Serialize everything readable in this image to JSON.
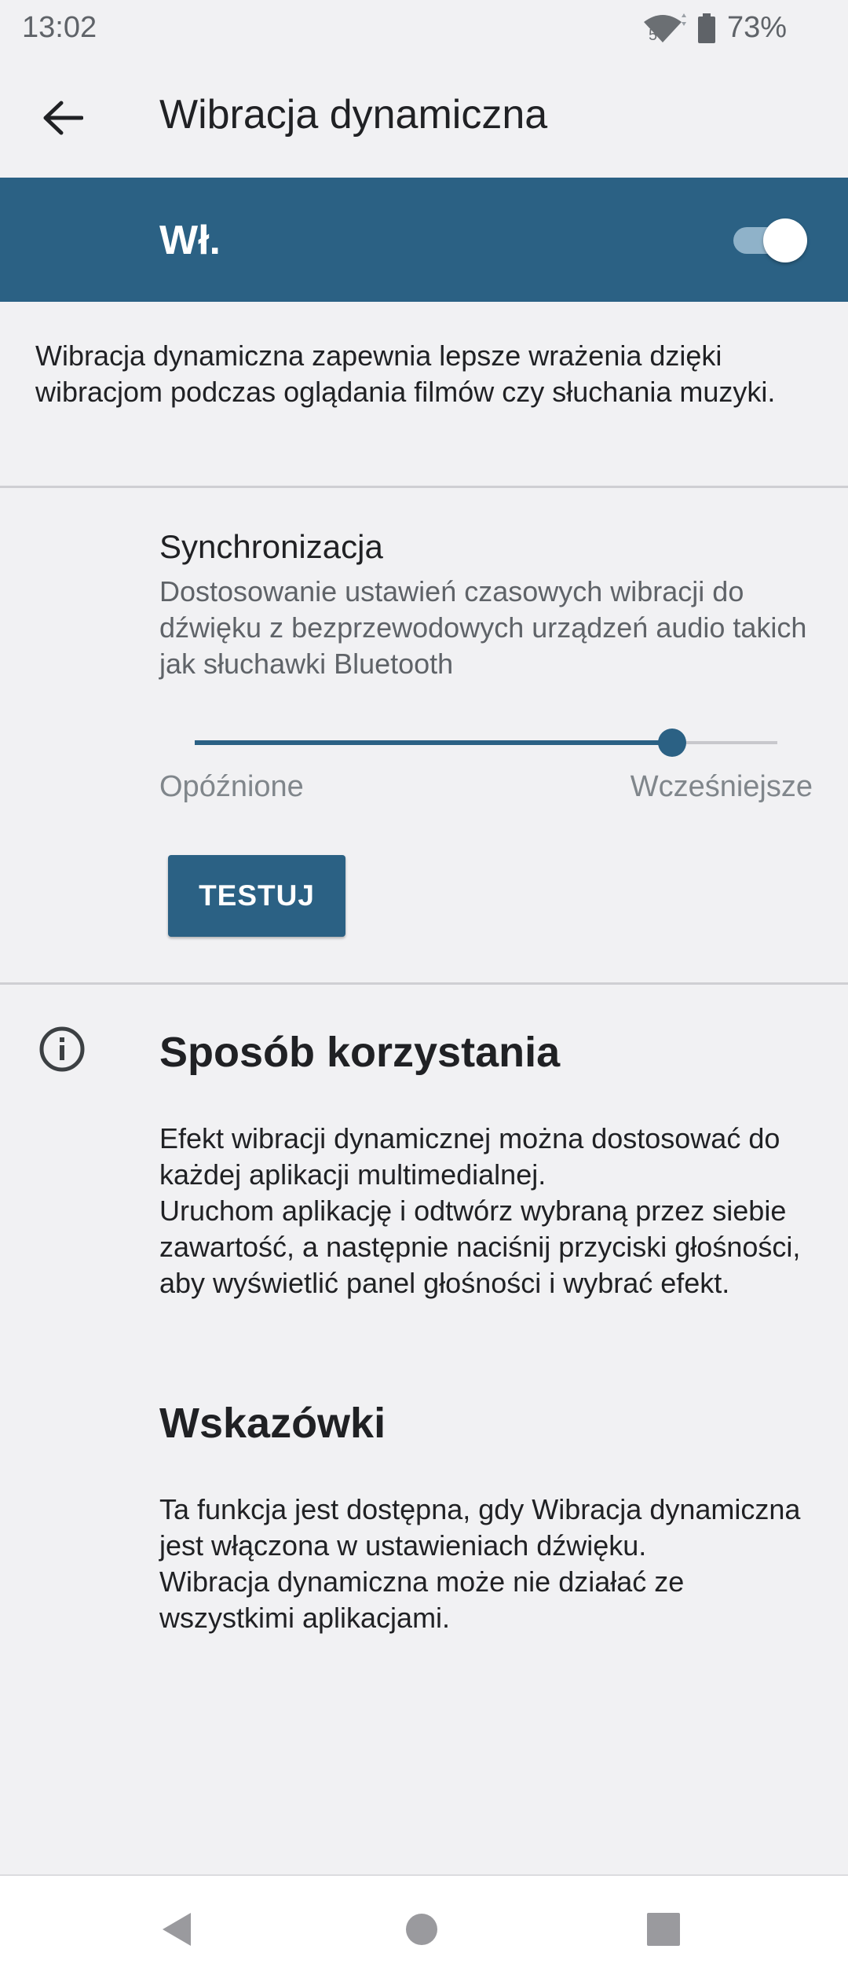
{
  "status_bar": {
    "time": "13:02",
    "battery": "73%",
    "network_label": "5"
  },
  "header": {
    "title": "Wibracja dynamiczna"
  },
  "master_switch": {
    "label": "Wł.",
    "on": true,
    "accent_color": "#2b6184"
  },
  "description": "Wibracja dynamiczna zapewnia lepsze wrażenia dzięki wibracjom podczas oglądania filmów czy słuchania muzyki.",
  "sync": {
    "title": "Synchronizacja",
    "description": "Dostosowanie ustawień czasowych wibracji do dźwięku z bezprzewodowych urządzeń audio takich jak słuchawki Bluetooth",
    "slider_value": 0.82,
    "min_label": "Opóźnione",
    "max_label": "Wcześniejsze",
    "test_button": "TESTUJ"
  },
  "how_to": {
    "heading": "Sposób korzystania",
    "body": [
      "Efekt wibracji dynamicznej można dostosować do każdej aplikacji multimedialnej.",
      "Uruchom aplikację i odtwórz wybraną przez siebie zawartość, a następnie naciśnij przyciski głośności, aby wyświetlić panel głośności i wybrać efekt."
    ]
  },
  "tips": {
    "heading": "Wskazówki",
    "body": [
      "Ta funkcja jest dostępna, gdy Wibracja dynamiczna jest włączona w ustawieniach dźwięku.",
      "Wibracja dynamiczna może nie działać ze wszystkimi aplikacjami."
    ]
  },
  "icons": {
    "back": "arrow-back-icon",
    "info": "info-icon",
    "wifi": "wifi-icon",
    "battery": "battery-icon",
    "nav_back": "nav-back-icon",
    "nav_home": "nav-home-icon",
    "nav_recents": "nav-recents-icon"
  }
}
